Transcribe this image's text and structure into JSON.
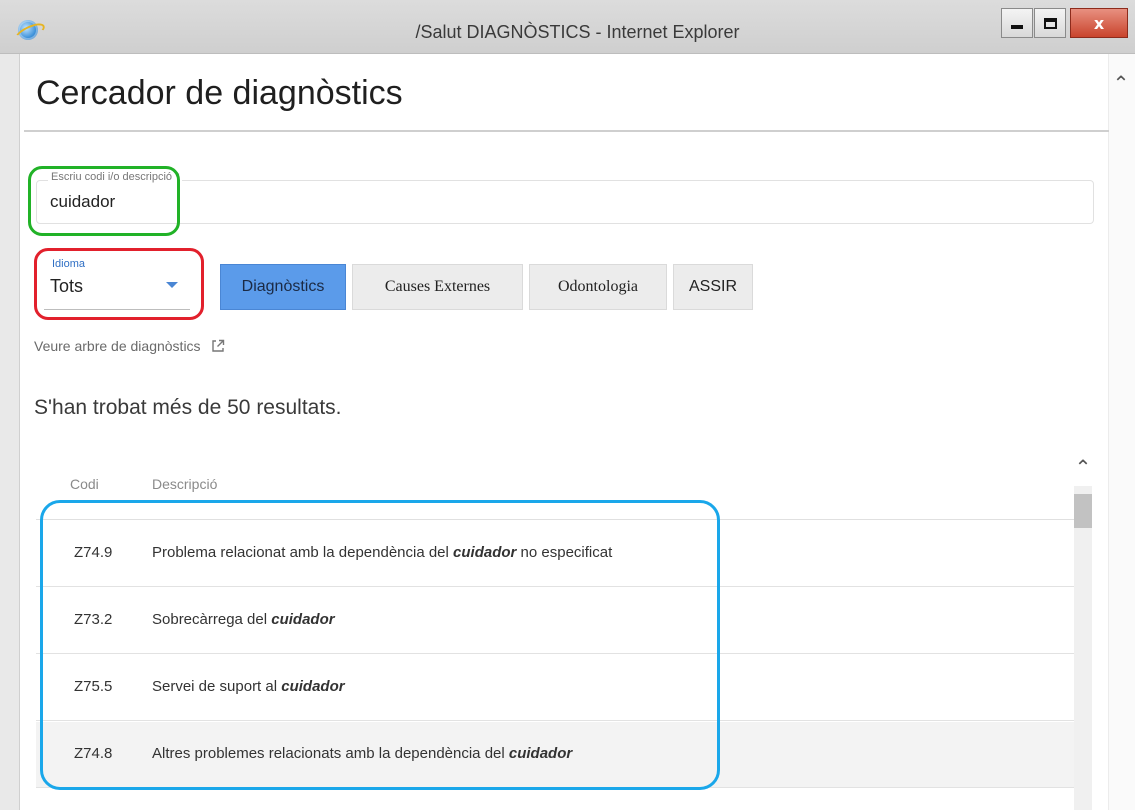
{
  "window": {
    "title": "/Salut DIAGNÒSTICS - Internet Explorer",
    "close_label": "x"
  },
  "page": {
    "title": "Cercador de diagnòstics"
  },
  "search": {
    "label": "Escriu codi i/o descripció *",
    "value": "cuidador"
  },
  "language": {
    "label": "Idioma",
    "selected": "Tots"
  },
  "tabs": [
    {
      "label": "Diagnòstics",
      "active": true
    },
    {
      "label": "Causes Externes",
      "active": false
    },
    {
      "label": "Odontologia",
      "active": false
    },
    {
      "label": "ASSIR",
      "active": false
    }
  ],
  "tree_link": {
    "label": "Veure arbre de diagnòstics",
    "icon": "external-link-icon"
  },
  "results": {
    "count_text": "S'han trobat més de 50 resultats.",
    "columns": [
      "Codi",
      "Descripció"
    ],
    "rows": [
      {
        "code": "Z74.9",
        "desc_before": "Problema relacionat amb la dependència del ",
        "desc_highlight": "cuidador",
        "desc_after": " no especificat"
      },
      {
        "code": "Z73.2",
        "desc_before": "Sobrecàrrega del ",
        "desc_highlight": "cuidador",
        "desc_after": ""
      },
      {
        "code": "Z75.5",
        "desc_before": "Servei de suport al ",
        "desc_highlight": "cuidador",
        "desc_after": ""
      },
      {
        "code": "Z74.8",
        "desc_before": "Altres problemes relacionats amb la dependència del ",
        "desc_highlight": "cuidador",
        "desc_after": ""
      }
    ]
  },
  "annotation_colors": {
    "search_box": "#21b227",
    "language_box": "#e2202c",
    "results_box": "#1aa7ea"
  },
  "colors": {
    "accent": "#5b9bea"
  }
}
